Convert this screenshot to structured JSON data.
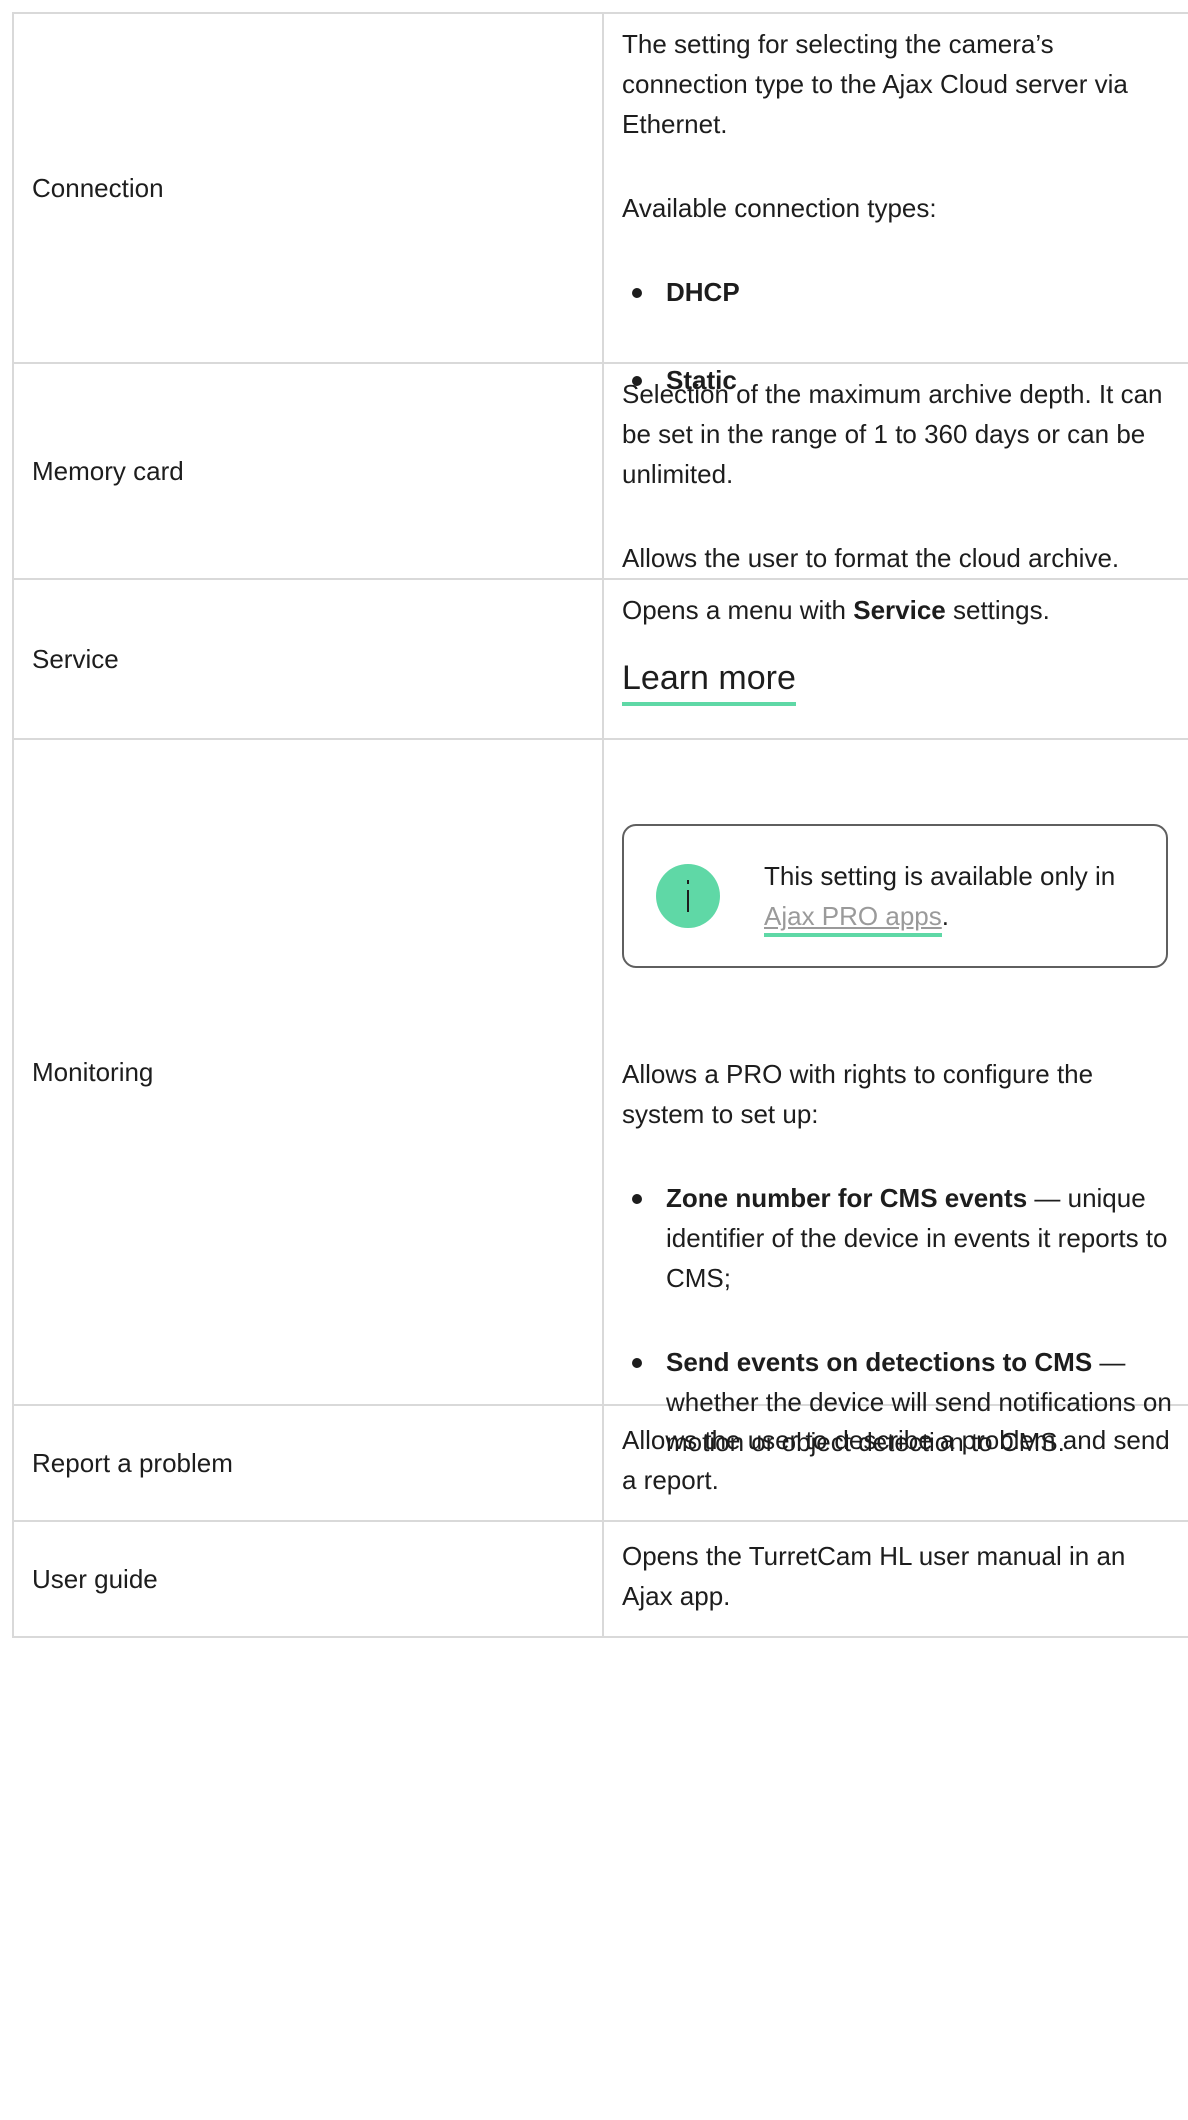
{
  "rows": [
    {
      "label": "Connection",
      "desc1": "The setting for selecting the camera’s connection type to the Ajax Cloud server via Ethernet.",
      "desc2": "Available connection types:",
      "bullets": [
        "DHCP",
        "Static"
      ]
    },
    {
      "label": "Memory card",
      "desc1": "Selection of the maximum archive depth. It can be set in the range of 1 to 360 days or can be unlimited.",
      "desc2": "Allows the user to format the cloud archive."
    },
    {
      "label": "Service",
      "desc_prefix": "Opens a menu with ",
      "desc_bold": "Service",
      "desc_suffix": " settings.",
      "link": "Learn more"
    },
    {
      "label": "Monitoring",
      "notice_text": "This setting is available only in ",
      "notice_link": "Ajax PRO apps",
      "notice_end": ".",
      "desc": "Allows a PRO with rights to configure the system to set up:",
      "items": [
        {
          "bold": "Zone number for CMS events",
          "text": " — unique identifier of the device in events it reports to CMS;"
        },
        {
          "bold": "Send events on detections to CMS",
          "text": " — whether the device will send notifications on motion or object detection to CMS."
        }
      ]
    },
    {
      "label": "Report a problem",
      "desc": "Allows the user to describe a problem and send a report."
    },
    {
      "label": "User guide",
      "desc": "Opens the TurretCam HL user manual in an Ajax app."
    }
  ],
  "colors": {
    "accent": "#5fd8a6",
    "border": "#d9d9d9",
    "link_gray": "#9a9a9a"
  },
  "icons": {
    "notice": "info-icon"
  }
}
